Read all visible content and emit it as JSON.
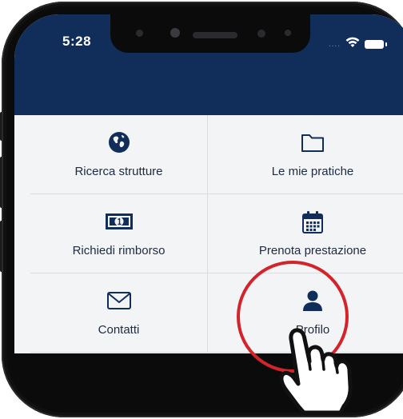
{
  "status_bar": {
    "time": "5:28",
    "signal_indicator": "....",
    "icons": [
      "wifi-icon",
      "battery-icon"
    ]
  },
  "menu": {
    "tiles": [
      {
        "label": "Ricerca strutture",
        "icon": "globe-icon"
      },
      {
        "label": "Le mie pratiche",
        "icon": "folder-icon"
      },
      {
        "label": "Richiedi rimborso",
        "icon": "banknote-icon"
      },
      {
        "label": "Prenota prestazione",
        "icon": "calendar-icon"
      },
      {
        "label": "Contatti",
        "icon": "envelope-icon"
      },
      {
        "label": "Profilo",
        "icon": "user-icon"
      }
    ]
  },
  "colors": {
    "header": "#112e5a",
    "icon": "#112e5a",
    "tile_background": "#f3f4f6",
    "highlight": "#d4242b"
  }
}
